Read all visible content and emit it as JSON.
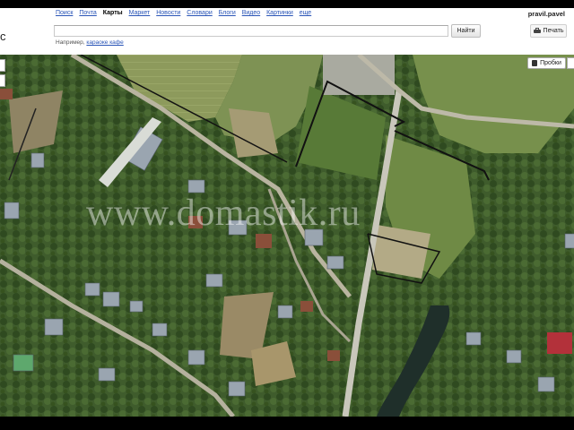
{
  "header": {
    "logo_fragment": "с",
    "nav": [
      {
        "label": "Поиск",
        "active": false
      },
      {
        "label": "Почта",
        "active": false
      },
      {
        "label": "Карты",
        "active": true
      },
      {
        "label": "Маркет",
        "active": false
      },
      {
        "label": "Новости",
        "active": false
      },
      {
        "label": "Словари",
        "active": false
      },
      {
        "label": "Блоги",
        "active": false
      },
      {
        "label": "Видео",
        "active": false
      },
      {
        "label": "Картинки",
        "active": false
      },
      {
        "label": "еще",
        "active": false
      }
    ],
    "user": "pravil.pavel",
    "search_value": "",
    "find_label": "Найти",
    "print_label": "Печать",
    "example_prefix": "Например,",
    "example_link": "караоке кафе"
  },
  "map": {
    "traffic_label": "Пробки",
    "watermark": "www.domastik.ru"
  }
}
